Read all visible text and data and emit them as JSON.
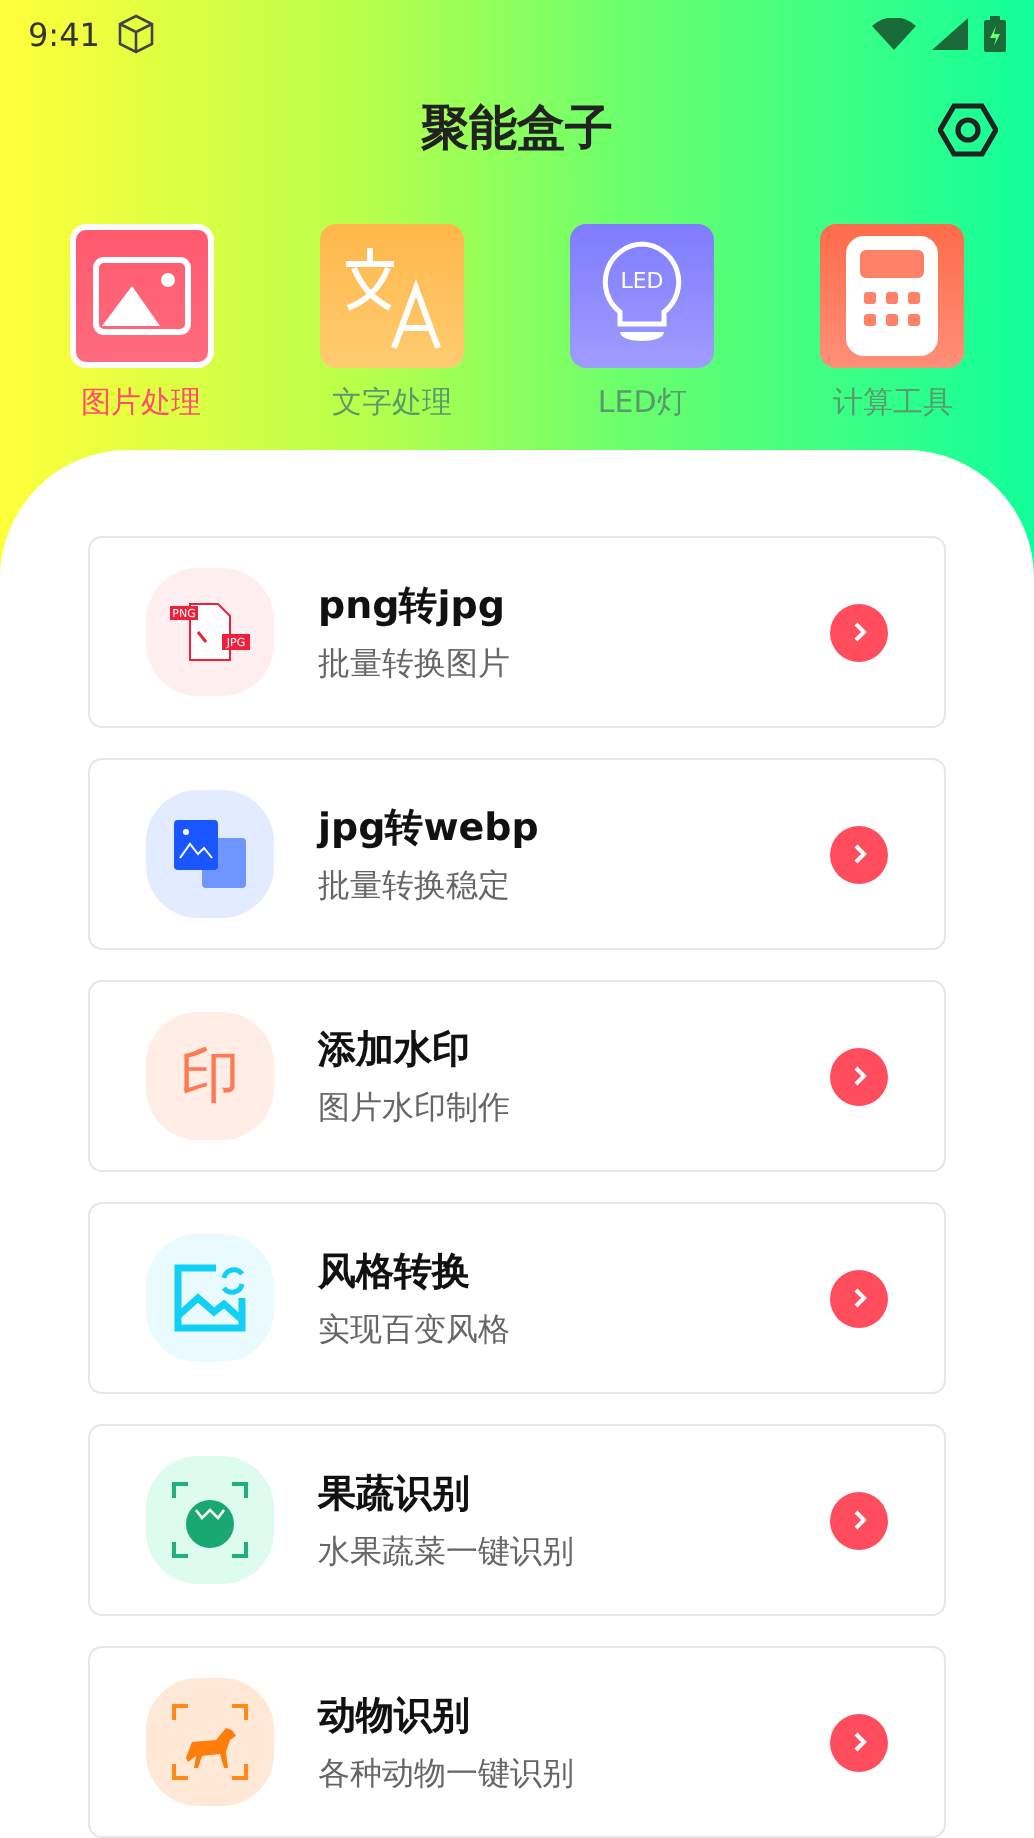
{
  "status_bar": {
    "time": "9:41"
  },
  "header": {
    "title": "聚能盒子"
  },
  "tabs": [
    {
      "label": "图片处理",
      "kind": "image",
      "selected": true
    },
    {
      "label": "文字处理",
      "kind": "translate",
      "selected": false
    },
    {
      "label": "LED灯",
      "kind": "bulb",
      "icon_text": "LED",
      "selected": false
    },
    {
      "label": "计算工具",
      "kind": "calculator",
      "selected": false
    }
  ],
  "tools": [
    {
      "title": "png转jpg",
      "subtitle": "批量转换图片",
      "kind": "convert",
      "icon_texts": [
        "PNG",
        "JPG"
      ]
    },
    {
      "title": "jpg转webp",
      "subtitle": "批量转换稳定",
      "kind": "images"
    },
    {
      "title": "添加水印",
      "subtitle": "图片水印制作",
      "kind": "glyph",
      "glyph": "印"
    },
    {
      "title": "风格转换",
      "subtitle": "实现百变风格",
      "kind": "style"
    },
    {
      "title": "果蔬识别",
      "subtitle": "水果蔬菜一键识别",
      "kind": "fruit"
    },
    {
      "title": "动物识别",
      "subtitle": "各种动物一键识别",
      "kind": "animal"
    }
  ]
}
